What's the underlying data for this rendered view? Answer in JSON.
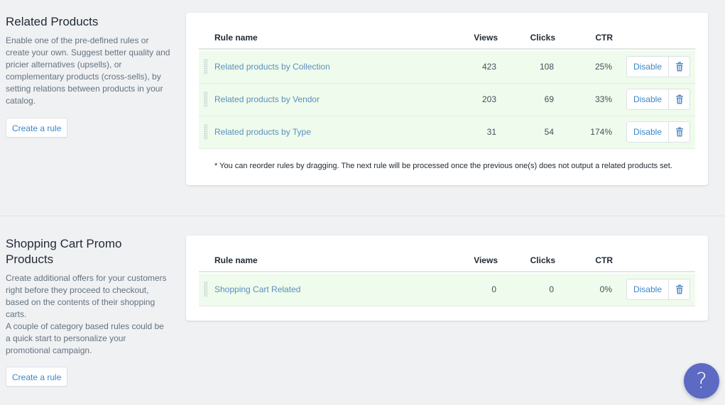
{
  "related": {
    "title": "Related Products",
    "description": "Enable one of the pre-defined rules or create your own. Suggest better quality and pricier alternatives (upsells), or complementary products (cross-sells), by setting relations between products in your catalog.",
    "create_label": "Create a rule",
    "columns": {
      "name": "Rule name",
      "views": "Views",
      "clicks": "Clicks",
      "ctr": "CTR"
    },
    "rows": [
      {
        "name": "Related products by Collection",
        "views": "423",
        "clicks": "108",
        "ctr": "25%",
        "action": "Disable"
      },
      {
        "name": "Related products by Vendor",
        "views": "203",
        "clicks": "69",
        "ctr": "33%",
        "action": "Disable"
      },
      {
        "name": "Related products by Type",
        "views": "31",
        "clicks": "54",
        "ctr": "174%",
        "action": "Disable"
      }
    ],
    "note": "* You can reorder rules by dragging. The next rule will be processed once the previous one(s) does not output a related products set."
  },
  "cart": {
    "title_line1": "Shopping Cart Promo",
    "title_line2": "Products",
    "description_1": "Create additional offers for your customers right before they proceed to checkout, based on the contents of their shopping carts.",
    "description_2": "A couple of category based rules could be a quick start to personalize your promotional campaign.",
    "create_label": "Create a rule",
    "columns": {
      "name": "Rule name",
      "views": "Views",
      "clicks": "Clicks",
      "ctr": "CTR"
    },
    "rows": [
      {
        "name": "Shopping Cart Related",
        "views": "0",
        "clicks": "0",
        "ctr": "0%",
        "action": "Disable"
      }
    ]
  },
  "help": {
    "label": "?"
  },
  "icons": {
    "trash": "trash-icon",
    "drag": "drag-handle-icon",
    "help": "question-mark-icon"
  },
  "colors": {
    "link": "#3a86c8",
    "row_bg": "#effbec",
    "help_bg": "#5c6ac4"
  }
}
